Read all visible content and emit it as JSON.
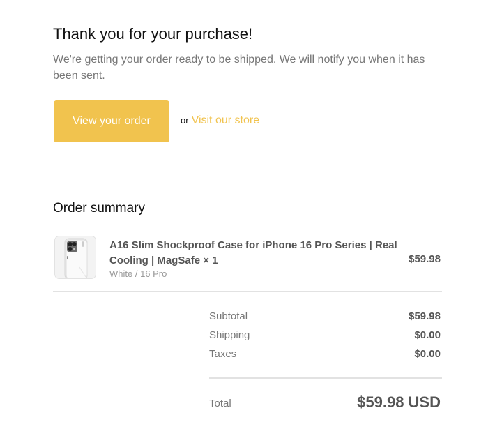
{
  "header": {
    "title": "Thank you for your purchase!",
    "message": "We're getting your order ready to be shipped. We will notify you when it has been sent."
  },
  "actions": {
    "view_order_label": "View your order",
    "or_text": "or",
    "visit_store_label": "Visit our store"
  },
  "summary": {
    "title": "Order summary",
    "items": [
      {
        "name": "A16 Slim Shockproof Case for iPhone 16 Pro Series | Real Cooling | MagSafe × 1",
        "variant": "White / 16 Pro",
        "price": "$59.98",
        "image": "phone-case-product-image"
      }
    ],
    "subtotal_label": "Subtotal",
    "subtotal_value": "$59.98",
    "shipping_label": "Shipping",
    "shipping_value": "$0.00",
    "taxes_label": "Taxes",
    "taxes_value": "$0.00",
    "total_label": "Total",
    "total_value": "$59.98 USD"
  },
  "colors": {
    "accent": "#f1c34e",
    "text_dark": "#111111",
    "text_muted": "#777777",
    "divider": "#e2e2e2"
  }
}
